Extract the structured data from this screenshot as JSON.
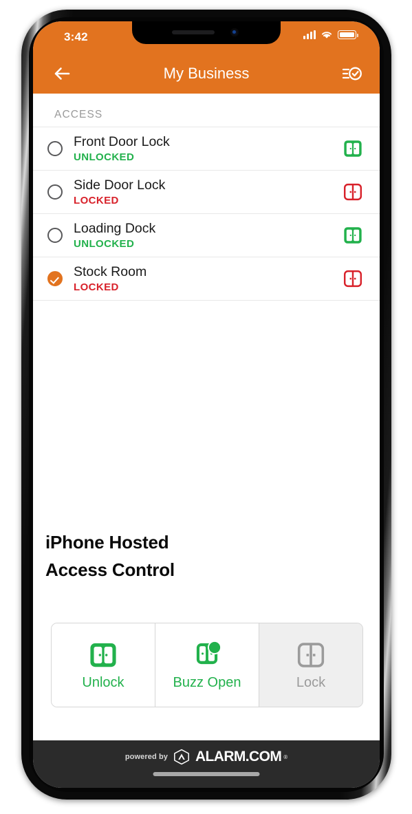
{
  "status_bar": {
    "time": "3:42",
    "signal_icon": "cellular-signal-icon",
    "wifi_icon": "wifi-icon",
    "battery_icon": "battery-full-icon"
  },
  "nav": {
    "title": "My Business",
    "back_icon": "back-arrow-icon",
    "action_icon": "list-check-icon"
  },
  "section": {
    "header": "ACCESS"
  },
  "locks": [
    {
      "name": "Front Door Lock",
      "status": "UNLOCKED",
      "state": "unlocked",
      "selected": false,
      "icon": "door-unlocked-icon"
    },
    {
      "name": "Side Door Lock",
      "status": "LOCKED",
      "state": "locked",
      "selected": false,
      "icon": "door-locked-icon"
    },
    {
      "name": "Loading Dock",
      "status": "UNLOCKED",
      "state": "unlocked",
      "selected": false,
      "icon": "door-unlocked-icon"
    },
    {
      "name": "Stock Room",
      "status": "LOCKED",
      "state": "locked",
      "selected": true,
      "icon": "door-locked-icon"
    }
  ],
  "overlay": {
    "line1": "iPhone Hosted",
    "line2": "Access Control"
  },
  "actions": [
    {
      "label": "Unlock",
      "icon": "door-unlock-icon",
      "enabled": true
    },
    {
      "label": "Buzz Open",
      "icon": "door-buzz-open-icon",
      "enabled": true
    },
    {
      "label": "Lock",
      "icon": "door-lock-icon",
      "enabled": false
    }
  ],
  "footer": {
    "prefix": "powered by",
    "brand": "ALARM.COM",
    "trademark": "®",
    "logo_icon": "alarm-com-hexagon-logo"
  },
  "colors": {
    "accent_orange": "#E2731F",
    "unlocked_green": "#22b14c",
    "locked_red": "#d8212a",
    "disabled_gray": "#9b9b9b",
    "footer_dark": "#2b2b2b"
  }
}
